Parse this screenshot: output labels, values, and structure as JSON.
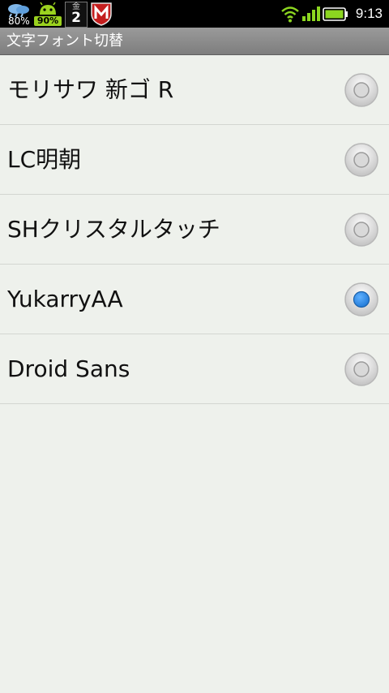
{
  "status_bar": {
    "weather_percent": "80%",
    "battery_badge": "90%",
    "calendar_dow": "金",
    "calendar_day": "2",
    "time": "9:13"
  },
  "title": "文字フォント切替",
  "fonts": [
    {
      "label": "モリサワ 新ゴ R",
      "selected": false
    },
    {
      "label": "LC明朝",
      "selected": false
    },
    {
      "label": "SHクリスタルタッチ",
      "selected": false
    },
    {
      "label": "YukarryAA",
      "selected": true
    },
    {
      "label": "Droid Sans",
      "selected": false
    }
  ],
  "colors": {
    "background": "#eef1ec",
    "radio_selected": "#1f78d6",
    "status_green": "#8cd620"
  },
  "icons": [
    "weather-icon",
    "android-icon",
    "calendar-icon",
    "mcafee-icon",
    "wifi-icon",
    "signal-icon",
    "battery-icon",
    "radio-icon"
  ]
}
